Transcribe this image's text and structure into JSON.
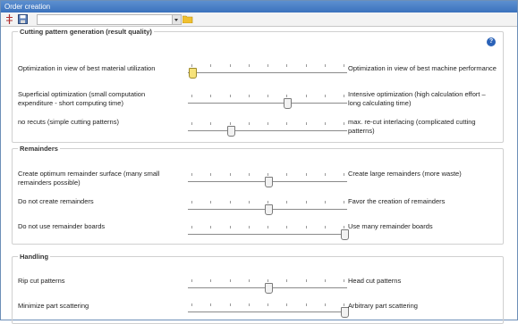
{
  "window": {
    "title": "Order creation"
  },
  "toolbar": {
    "combo_value": ""
  },
  "sections": [
    {
      "title": "Cutting pattern generation (result quality)",
      "rows": [
        {
          "left": "Optimization in view of best material utilization",
          "right": "Optimization in view of best machine performance",
          "value": 0,
          "active": true
        },
        {
          "left": "Superficial optimization (small computation expenditure - short computing time)",
          "right": "Intensive optimization (high calculation effort – long calculating time)",
          "value": 0.625,
          "active": false
        },
        {
          "left": "no recuts (simple cutting patterns)",
          "right": "max. re-cut interlacing (complicated cutting patterns)",
          "value": 0.25,
          "active": false
        }
      ]
    },
    {
      "title": "Remainders",
      "rows": [
        {
          "left": "Create optimum remainder surface (many small remainders possible)",
          "right": "Create large remainders (more waste)",
          "value": 0.5,
          "active": false
        },
        {
          "left": "Do not create remainders",
          "right": "Favor the creation of remainders",
          "value": 0.5,
          "active": false
        },
        {
          "left": "Do not use remainder boards",
          "right": "Use many remainder boards",
          "value": 1,
          "active": false
        }
      ]
    },
    {
      "title": "Handling",
      "rows": [
        {
          "left": "Rip cut patterns",
          "right": "Head cut patterns",
          "value": 0.5,
          "active": false
        },
        {
          "left": "Minimize part scattering",
          "right": "Arbitrary part scattering",
          "value": 1,
          "active": false
        }
      ]
    }
  ],
  "icons": {
    "scissors": "cutting-tool-icon",
    "save": "save-icon",
    "dropdown": "chevron-down-icon",
    "folder": "folder-icon",
    "help": "help-icon"
  },
  "help_label": "?",
  "colors": {
    "titlebar": "#3b72bd",
    "active_thumb": "#f6e27a",
    "help": "#2a62b8"
  }
}
